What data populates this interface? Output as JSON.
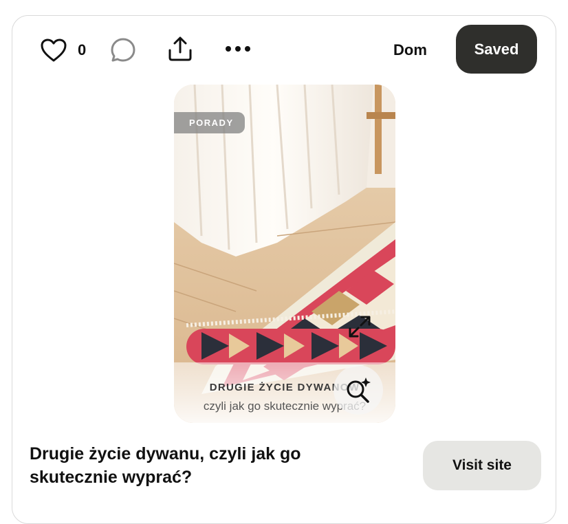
{
  "toolbar": {
    "like_count": "0",
    "board_name": "Dom",
    "saved_label": "Saved",
    "icons": [
      "heart-icon",
      "comment-icon",
      "share-icon",
      "more-icon"
    ]
  },
  "pin": {
    "badge": "PORADY",
    "overlay_title": "DRUGIE ŻYCIE DYWANOW",
    "overlay_subtitle": "czyli jak go skutecznie wyprać?",
    "title": "Drugie życie dywanu, czyli jak go skutecznie wyprać?",
    "visit_label": "Visit site"
  },
  "colors": {
    "saved_bg": "#2f2f2c",
    "visit_bg": "#e6e6e3",
    "border": "#d9d9d9"
  }
}
